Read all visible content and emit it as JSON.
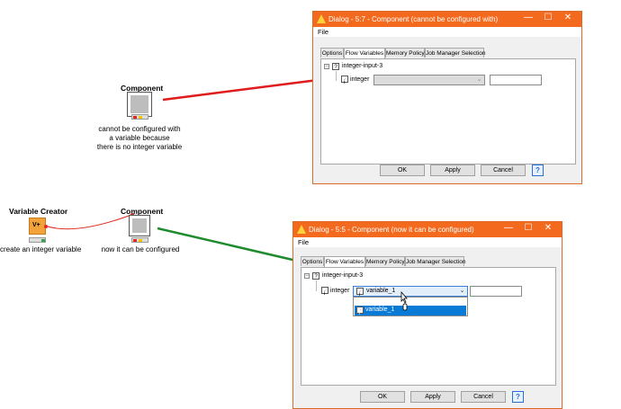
{
  "workflow": {
    "component_top": {
      "title": "Component",
      "caption_lines": [
        "cannot be configured with",
        "a variable because",
        "there is no integer variable"
      ]
    },
    "variable_creator": {
      "title": "Variable Creator",
      "icon_text": "V+",
      "caption": "create an integer variable"
    },
    "component_bottom": {
      "title": "Component",
      "caption": "now it can be configured"
    },
    "colors": {
      "red_arrow": "#e01b1b",
      "green_arrow": "#1e8b2e",
      "node_orange": "#f3a23a"
    }
  },
  "dialog_top": {
    "title": "Dialog - 5:7 - Component (cannot be configured with)",
    "menu": "File",
    "tabs": [
      "Options",
      "Flow Variables",
      "Memory Policy",
      "Job Manager Selection"
    ],
    "active_tab": "Flow Variables",
    "tree_root": "integer-input-3",
    "param_label": "integer",
    "combo_value": "",
    "buttons": {
      "ok": "OK",
      "apply": "Apply",
      "cancel": "Cancel",
      "help": "?"
    }
  },
  "dialog_bottom": {
    "title": "Dialog - 5:5 - Component (now it can be configured)",
    "menu": "File",
    "tabs": [
      "Options",
      "Flow Variables",
      "Memory Policy",
      "Job Manager Selection"
    ],
    "active_tab": "Flow Variables",
    "tree_root": "integer-input-3",
    "param_label": "integer",
    "combo_value": "variable_1",
    "dropdown_option": "variable_1",
    "buttons": {
      "ok": "OK",
      "apply": "Apply",
      "cancel": "Cancel",
      "help": "?"
    }
  },
  "window_controls": {
    "minimize": "—",
    "maximize": "☐",
    "close": "✕"
  },
  "icons": [
    "warning-icon",
    "tree-collapse-icon",
    "question-mark-icon",
    "integer-variable-icon",
    "chevron-down-icon",
    "mouse-cursor-icon"
  ]
}
